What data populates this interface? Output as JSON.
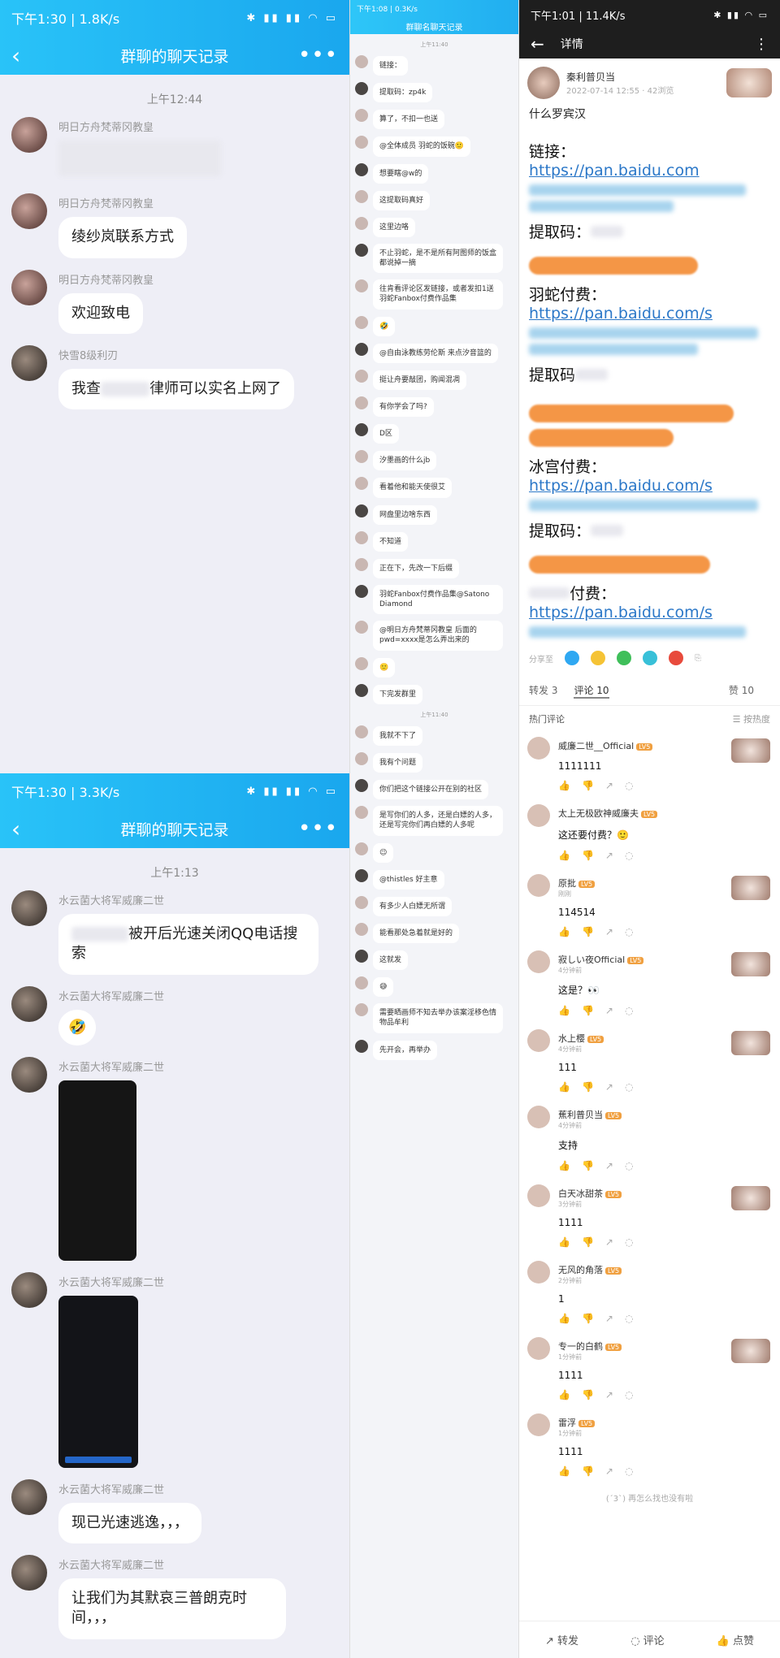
{
  "panel1": {
    "status_time": "下午1:30 | 1.8K/s",
    "title": "群聊的聊天记录",
    "time": "上午12:44",
    "msgs": [
      {
        "nick": "明日方舟梵蒂冈教皇",
        "text": ""
      },
      {
        "nick": "明日方舟梵蒂冈教皇",
        "text": "绫纱岚联系方式"
      },
      {
        "nick": "明日方舟梵蒂冈教皇",
        "text": "欢迎致电"
      },
      {
        "nick": "快雪8级利刃",
        "text": "我查",
        "text2": "律师可以实名上网了"
      }
    ]
  },
  "panel2": {
    "status_time": "下午1:30 | 3.3K/s",
    "title": "群聊的聊天记录",
    "time": "上午1:13",
    "msgs": [
      {
        "nick": "水云菌大将军威廉二世",
        "text": "被开后光速关闭QQ电话搜索"
      },
      {
        "nick": "水云菌大将军威廉二世",
        "text": "🤣"
      },
      {
        "nick": "水云菌大将军威廉二世",
        "text": ""
      },
      {
        "nick": "水云菌大将军威廉二世",
        "text": ""
      },
      {
        "nick": "水云菌大将军威廉二世",
        "text": "现已光速逃逸，，，"
      },
      {
        "nick": "水云菌大将军威廉二世",
        "text": "让我们为其默哀三普朗克时间，，，"
      }
    ]
  },
  "middle": {
    "status": "下午1:08 | 0.3K/s",
    "title": "群聊名聊天记录",
    "times": [
      "上午11:40",
      "上午11:40"
    ],
    "msgs": [
      "链接：",
      "提取码：zp4k",
      "算了，不扣一也送",
      "@全体成员 羽蛇的饭碗🙂",
      "想要瞎@w的",
      "这提取码真好",
      "这里边咯",
      "不止羽蛇，是不是所有阿图师的饭盒都说掉一摘",
      "往肯看评论区发链接，或者发扣1送羽蛇Fanbox付费作品集",
      "🤣",
      "@自由泳教练劳伦斯 来点汐音篮的",
      "挺让舟要敲团，购闻混凋",
      "有你学会了吗?",
      "D区",
      "汐墨画的什么jb",
      "看着他和能天使很艾",
      "网盘里边啥东西",
      "不知道",
      "正在下，先改一下后缀",
      "羽蛇Fanbox付费作品集@Satono Diamond",
      "@明日方舟梵蒂冈教皇 后面的pwd=xxxx是怎么弄出来的",
      "🙂",
      "下完发群里",
      "我就不下了",
      "我有个问题",
      "你们把这个链接公开在别的社区",
      "是写你们的人多，还是白嫖的人多，还是写完你们再白嫖的人多呢",
      "😉",
      "@thistles 好主意",
      "有多少人白嫖无所谓",
      "能看那处急着就是好的",
      "这就发",
      "😅",
      "需要晒画师不知去举办该案淫移色情物品牟利",
      "先开会，再举办"
    ]
  },
  "right": {
    "status_time": "下午1:01 | 11.4K/s",
    "nav_title": "详情",
    "author": "秦利普贝当",
    "date": "2022-07-14 12:55 · 42浏览",
    "post_title": "什么罗宾汉",
    "labels": {
      "link": "链接：",
      "code": "提取码：",
      "yushe": "羽蛇付费：",
      "code2": "提取码",
      "bingong": "冰宫付费：",
      "code3": "提取码：",
      "pay4": "付费："
    },
    "url": "https://pan.baidu.com",
    "url_s": "https://pan.baidu.com/s",
    "share": "分享至",
    "tabs": {
      "forward": "转发 3",
      "comment": "评论 10",
      "like": "赞 10"
    },
    "hot": "热门评论",
    "sort": "☰ 按热度",
    "comments": [
      {
        "name": "威廉二世__Official",
        "time": "",
        "text": "1111111"
      },
      {
        "name": "太上无极欧神威廉夫",
        "time": "",
        "text": "这还要付费？🙂"
      },
      {
        "name": "原批",
        "time": "刚刚",
        "text": "114514"
      },
      {
        "name": "寂しい夜Official",
        "time": "4分钟前",
        "text": "这是？👀"
      },
      {
        "name": "水上樱",
        "time": "4分钟前",
        "text": "111"
      },
      {
        "name": "蕉利普贝当",
        "time": "4分钟前",
        "text": "支持"
      },
      {
        "name": "白天冰甜茶",
        "time": "3分钟前",
        "text": "1111"
      },
      {
        "name": "无风的角落",
        "time": "2分钟前",
        "text": "1"
      },
      {
        "name": "专一的白鹤",
        "time": "1分钟前",
        "text": "1111"
      },
      {
        "name": "雷浮",
        "time": "1分钟前",
        "text": "1111"
      }
    ],
    "endnote": "(ˊ3ˋ) 再怎么找也没有啦",
    "footer": {
      "forward": "转发",
      "comment": "评论",
      "like": "点赞"
    }
  }
}
